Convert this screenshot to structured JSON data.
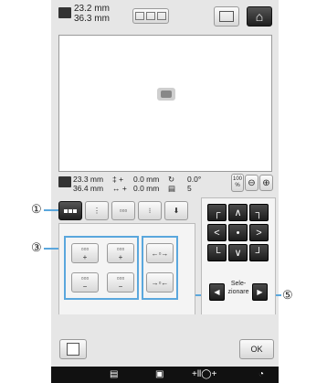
{
  "header": {
    "size_w": "23.2 mm",
    "size_h": "36.3 mm",
    "home_icon": "home-icon",
    "layout_icon": "layout-icon"
  },
  "info": {
    "size_w": "23.3 mm",
    "size_h": "36.4 mm",
    "v_offset_label": "‡ +",
    "v_offset": "0.0 mm",
    "h_offset_label": "↔ +",
    "h_offset": "0.0 mm",
    "angle": "0.0°",
    "count": "5",
    "zoom": "100 %"
  },
  "callouts": {
    "one": "①",
    "three": "③",
    "five": "⑤"
  },
  "spacing_buttons": [
    {
      "name": "spacing-h-increase-button",
      "glyph": "+"
    },
    {
      "name": "spacing-h2-increase-button",
      "glyph": "+"
    },
    {
      "name": "spacing-h-decrease-button",
      "glyph": "−"
    },
    {
      "name": "spacing-h2-decrease-button",
      "glyph": "−"
    }
  ],
  "arrows": {
    "up_left": "┌",
    "up": "∧",
    "up_right": "┐",
    "left": "<",
    "center": "•",
    "right": ">",
    "down_left": "└",
    "down": "∨",
    "down_right": "┘"
  },
  "select": {
    "label": "Sele-zionare",
    "prev": "◀",
    "next": "▶"
  },
  "ok_label": "OK",
  "bottom_bar": {
    "icons": [
      "▤",
      "▣",
      "+ll◯+",
      "◔"
    ]
  }
}
